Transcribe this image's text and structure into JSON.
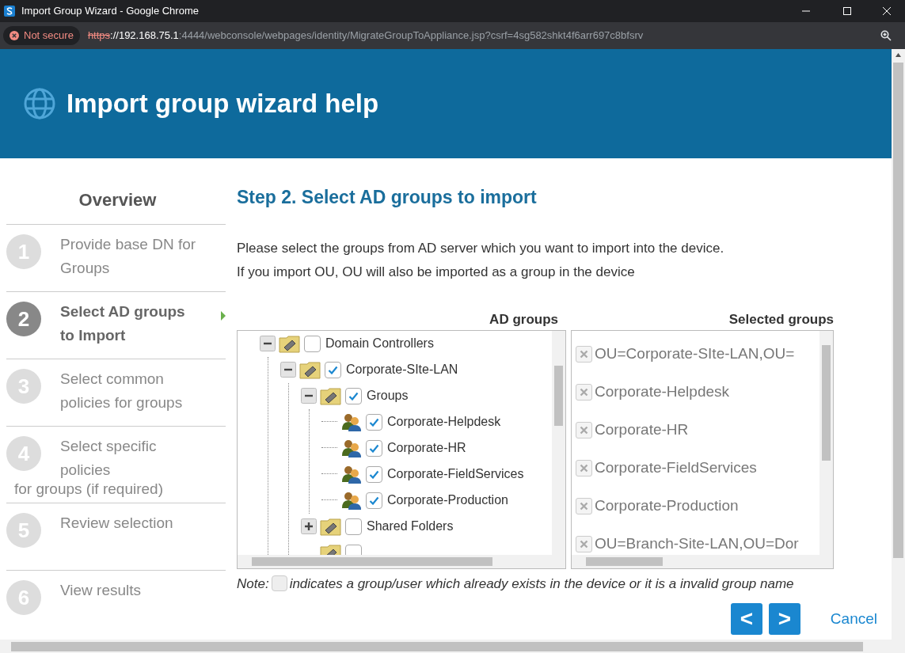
{
  "window": {
    "title": "Import Group Wizard - Google Chrome"
  },
  "address_bar": {
    "security": "Not secure",
    "scheme": "https",
    "host": "://192.168.75.1",
    "rest": ":4444/webconsole/webpages/identity/MigrateGroupToAppliance.jsp?csrf=4sg582shkt4f6arr697c8bfsrv"
  },
  "header": {
    "title": "Import group wizard help"
  },
  "sidebar": {
    "title": "Overview",
    "steps": [
      {
        "number": "1",
        "label": "Provide base DN for  Groups",
        "selected": false
      },
      {
        "number": "2",
        "label": "Select AD groups to  Import",
        "selected": true
      },
      {
        "number": "3",
        "label": "Select common policies  for groups",
        "selected": false
      },
      {
        "number": "4",
        "label": "Select specific policies",
        "label_continued": "for groups (if required)",
        "selected": false
      },
      {
        "number": "5",
        "label": "Review selection",
        "selected": false
      },
      {
        "number": "6",
        "label": "View results",
        "selected": false
      }
    ]
  },
  "main": {
    "title": "Step 2. Select AD groups to import",
    "description": [
      "Please select the groups from AD server which you want to import into the device.",
      "If you import OU, OU will also be imported as a group in the device"
    ]
  },
  "ad_groups": {
    "heading": "AD groups",
    "tree": [
      {
        "label": "Domain Controllers",
        "kind": "folder",
        "expanded": true,
        "checked": false,
        "children": [
          {
            "label": "Corporate-SIte-LAN",
            "kind": "folder",
            "expanded": true,
            "checked": true,
            "children": [
              {
                "label": "Groups",
                "kind": "folder",
                "expanded": true,
                "checked": true,
                "children": [
                  {
                    "label": "Corporate-Helpdesk",
                    "kind": "group",
                    "checked": true
                  },
                  {
                    "label": "Corporate-HR",
                    "kind": "group",
                    "checked": true
                  },
                  {
                    "label": "Corporate-FieldServices",
                    "kind": "group",
                    "checked": true
                  },
                  {
                    "label": "Corporate-Production",
                    "kind": "group",
                    "checked": true
                  }
                ]
              },
              {
                "label": "Shared Folders",
                "kind": "folder",
                "expanded": false,
                "checked": false
              },
              {
                "kind": "folder",
                "checked": false
              }
            ]
          }
        ]
      }
    ]
  },
  "selected_groups": {
    "heading": "Selected groups",
    "items": [
      "OU=Corporate-SIte-LAN,OU=",
      "Corporate-Helpdesk",
      "Corporate-HR",
      "Corporate-FieldServices",
      "Corporate-Production",
      "OU=Branch-Site-LAN,OU=Dor"
    ]
  },
  "note": {
    "prefix": "Note:",
    "text": "indicates a group/user which already exists in the device or it is a invalid group name"
  },
  "buttons": [
    {
      "label": "<",
      "kind": "back"
    },
    {
      "label": ">",
      "kind": "next"
    },
    {
      "label": "Cancel",
      "kind": "cancel"
    }
  ]
}
